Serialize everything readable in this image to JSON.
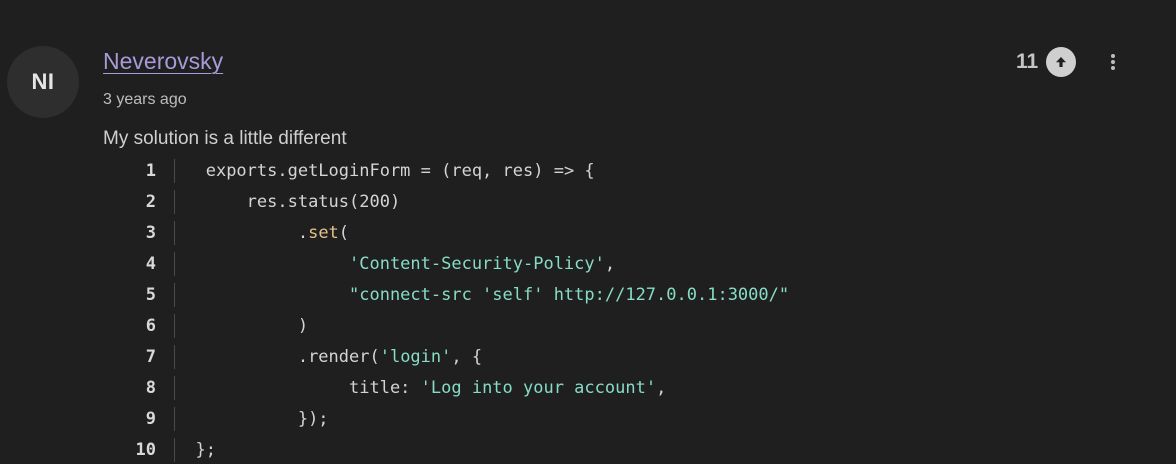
{
  "comment": {
    "avatar_initials": "NI",
    "author": "Neverovsky",
    "timestamp": "3 years ago",
    "vote_count": "11",
    "text": "My solution is a little different"
  },
  "icons": {
    "upvote": "arrow-up-icon",
    "more": "more-vertical-icon"
  },
  "colors": {
    "background": "#1f1f1f",
    "author_link": "#a89ad6",
    "string": "#86dcc5",
    "method": "#e5c28a"
  },
  "code": {
    "lines": [
      {
        "num": "1",
        "indent": "   ",
        "parts": [
          {
            "t": "exports.getLoginForm = (req, res) => {",
            "c": ""
          }
        ]
      },
      {
        "num": "2",
        "indent": "       ",
        "parts": [
          {
            "t": "res.status(200)",
            "c": ""
          }
        ]
      },
      {
        "num": "3",
        "indent": "            ",
        "parts": [
          {
            "t": ".",
            "c": ""
          },
          {
            "t": "set",
            "c": "tok-method"
          },
          {
            "t": "(",
            "c": ""
          }
        ]
      },
      {
        "num": "4",
        "indent": "                 ",
        "parts": [
          {
            "t": "'Content-Security-Policy'",
            "c": "tok-string"
          },
          {
            "t": ",",
            "c": ""
          }
        ]
      },
      {
        "num": "5",
        "indent": "                 ",
        "parts": [
          {
            "t": "\"connect-src 'self' http://127.0.0.1:3000/\"",
            "c": "tok-string"
          }
        ]
      },
      {
        "num": "6",
        "indent": "            ",
        "parts": [
          {
            "t": ")",
            "c": ""
          }
        ]
      },
      {
        "num": "7",
        "indent": "            ",
        "parts": [
          {
            "t": ".render(",
            "c": ""
          },
          {
            "t": "'login'",
            "c": "tok-string"
          },
          {
            "t": ", {",
            "c": ""
          }
        ]
      },
      {
        "num": "8",
        "indent": "                 ",
        "parts": [
          {
            "t": "title: ",
            "c": ""
          },
          {
            "t": "'Log into your account'",
            "c": "tok-string"
          },
          {
            "t": ",",
            "c": ""
          }
        ]
      },
      {
        "num": "9",
        "indent": "            ",
        "parts": [
          {
            "t": "});",
            "c": ""
          }
        ]
      },
      {
        "num": "10",
        "indent": "  ",
        "parts": [
          {
            "t": "};",
            "c": ""
          }
        ]
      }
    ]
  }
}
